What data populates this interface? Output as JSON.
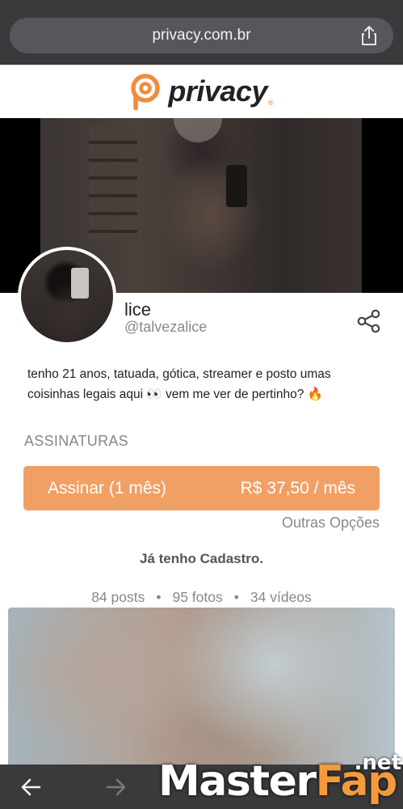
{
  "browser": {
    "url": "privacy.com.br",
    "share_icon": "share-icon",
    "back_icon": "arrow-left-icon",
    "forward_icon": "arrow-right-icon"
  },
  "header": {
    "logo_text": "privacy",
    "brand_color": "#f08c3c"
  },
  "profile": {
    "name": "lice",
    "handle": "@talvezalice",
    "bio_line1": "tenho 21 anos, tatuada, gótica, streamer e posto umas",
    "bio_line2": "coisinhas legais aqui 👀 vem me ver de pertinho? 🔥"
  },
  "subscriptions": {
    "title": "ASSINATURAS",
    "plan_label": "Assinar (1 mês)",
    "plan_price": "R$ 37,50 / mês",
    "button_color": "#f1a065",
    "other_options": "Outras Opções",
    "have_account": "Já tenho Cadastro."
  },
  "stats": {
    "posts": "84 posts",
    "photos": "95 fotos",
    "videos": "34 vídeos",
    "separator": "•"
  },
  "watermark": {
    "net": ".net",
    "master": "Master",
    "fap": "Fap"
  }
}
